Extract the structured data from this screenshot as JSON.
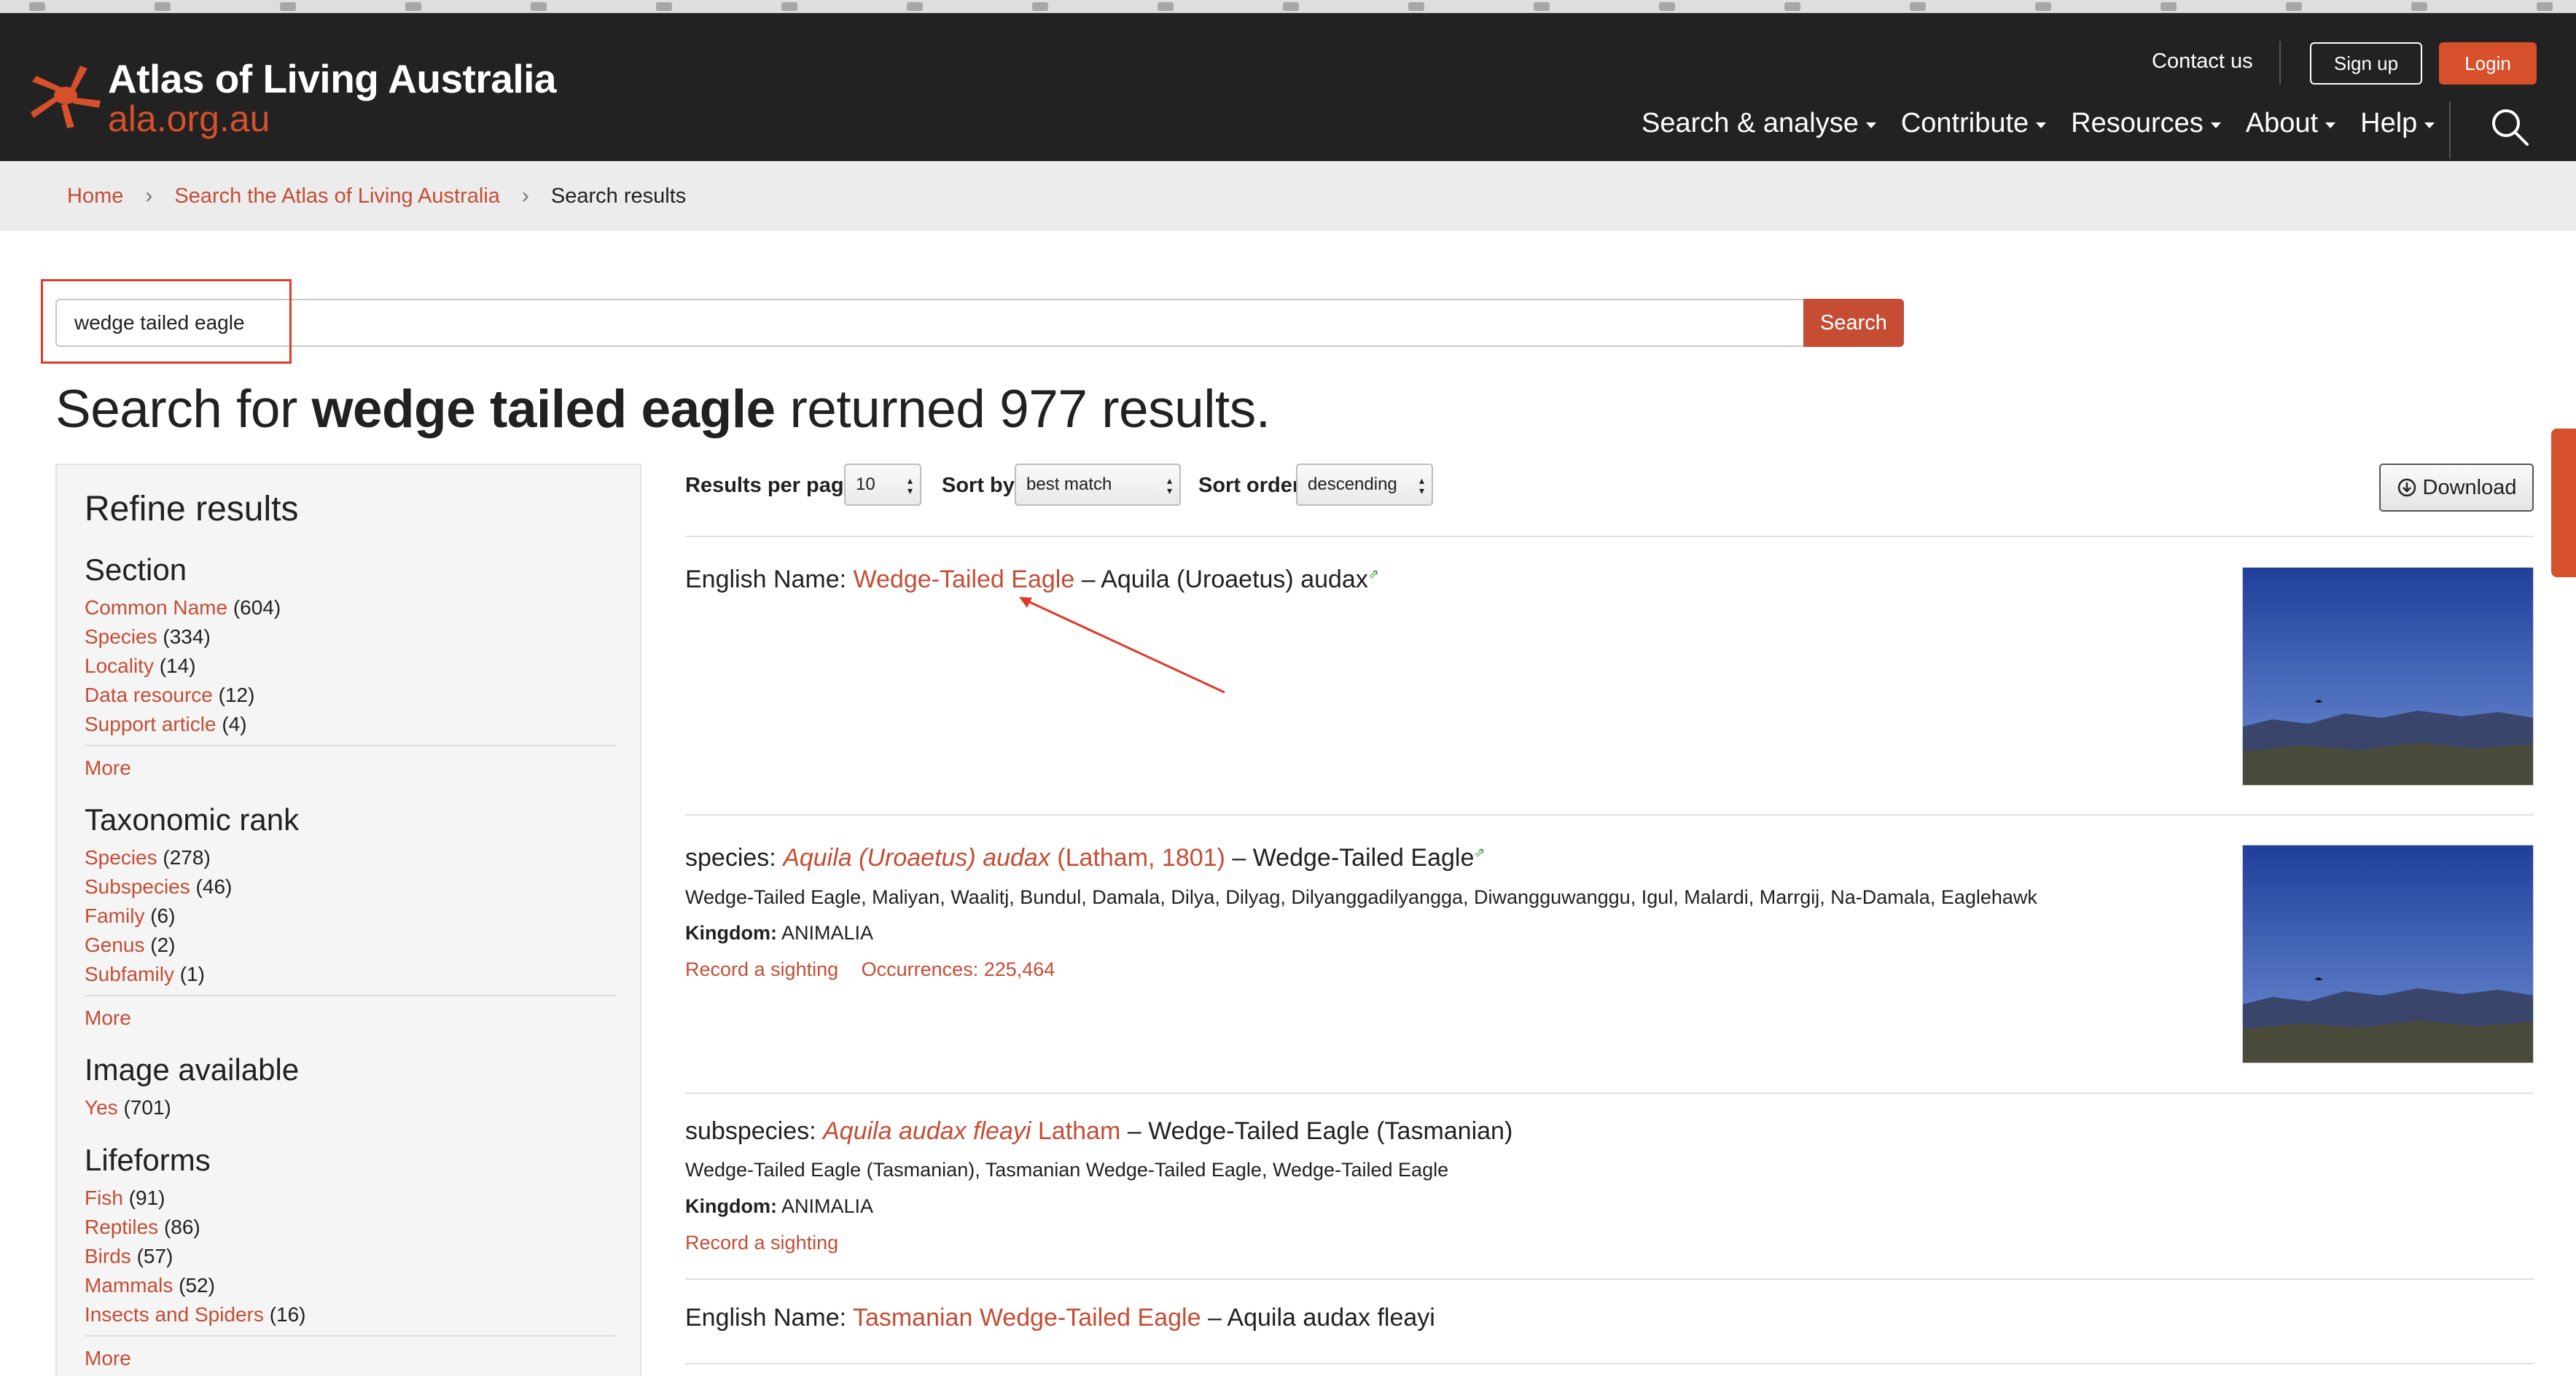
{
  "header": {
    "site_name": "Atlas of Living Australia",
    "site_domain": "ala.org.au",
    "contact_label": "Contact us",
    "signup_label": "Sign up",
    "login_label": "Login",
    "nav": [
      "Search & analyse",
      "Contribute",
      "Resources",
      "About",
      "Help"
    ]
  },
  "breadcrumb": {
    "home": "Home",
    "search": "Search the Atlas of Living Australia",
    "current": "Search results"
  },
  "search": {
    "value": "wedge tailed eagle",
    "button_label": "Search"
  },
  "headline": {
    "prefix": "Search for",
    "query": "wedge tailed eagle",
    "suffix": "returned 977 results."
  },
  "refine": {
    "title": "Refine results",
    "more_label": "More",
    "facets": [
      {
        "title": "Section",
        "items": [
          {
            "label": "Common Name",
            "count": "(604)"
          },
          {
            "label": "Species",
            "count": "(334)"
          },
          {
            "label": "Locality",
            "count": "(14)"
          },
          {
            "label": "Data resource",
            "count": "(12)"
          },
          {
            "label": "Support article",
            "count": "(4)"
          }
        ]
      },
      {
        "title": "Taxonomic rank",
        "items": [
          {
            "label": "Species",
            "count": "(278)"
          },
          {
            "label": "Subspecies",
            "count": "(46)"
          },
          {
            "label": "Family",
            "count": "(6)"
          },
          {
            "label": "Genus",
            "count": "(2)"
          },
          {
            "label": "Subfamily",
            "count": "(1)"
          }
        ]
      },
      {
        "title": "Image available",
        "items": [
          {
            "label": "Yes",
            "count": "(701)"
          }
        ]
      },
      {
        "title": "Lifeforms",
        "items": [
          {
            "label": "Fish",
            "count": "(91)"
          },
          {
            "label": "Reptiles",
            "count": "(86)"
          },
          {
            "label": "Birds",
            "count": "(57)"
          },
          {
            "label": "Mammals",
            "count": "(52)"
          },
          {
            "label": "Insects and Spiders",
            "count": "(16)"
          }
        ]
      }
    ]
  },
  "controls": {
    "per_page_label": "Results per page",
    "per_page_value": "10",
    "sort_by_label": "Sort by",
    "sort_by_value": "best match",
    "sort_order_label": "Sort order",
    "sort_order_value": "descending",
    "download_label": "Download"
  },
  "results": [
    {
      "label": "English Name:",
      "link": "Wedge-Tailed Eagle",
      "rest": "– Aquila (Uroaetus) audax"
    },
    {
      "label": "species:",
      "link_italic": "Aquila (Uroaetus) audax",
      "link_author": "(Latham, 1801)",
      "rest": "– Wedge-Tailed Eagle",
      "names": "Wedge-Tailed Eagle, Maliyan, Waalitj, Bundul, Damala, Dilya, Dilyag, Dilyanggadilyangga, Diwangguwanggu, Igul, Malardi, Marrgij, Na-Damala, Eaglehawk",
      "kingdom_label": "Kingdom:",
      "kingdom": "ANIMALIA",
      "record_label": "Record a sighting",
      "occurrences_label": "Occurrences: 225,464"
    },
    {
      "label": "subspecies:",
      "link_italic": "Aquila audax fleayi",
      "link_author": "Latham",
      "rest": "– Wedge-Tailed Eagle (Tasmanian)",
      "names": "Wedge-Tailed Eagle (Tasmanian), Tasmanian Wedge-Tailed Eagle, Wedge-Tailed Eagle",
      "kingdom_label": "Kingdom:",
      "kingdom": "ANIMALIA",
      "record_label": "Record a sighting"
    },
    {
      "label": "English Name:",
      "link": "Tasmanian Wedge-Tailed Eagle",
      "rest": "– Aquila audax fleayi"
    }
  ],
  "colors": {
    "brand": "#d5502b",
    "link": "#c44d34",
    "header_bg": "#222222",
    "annotation": "#e03a2c"
  }
}
